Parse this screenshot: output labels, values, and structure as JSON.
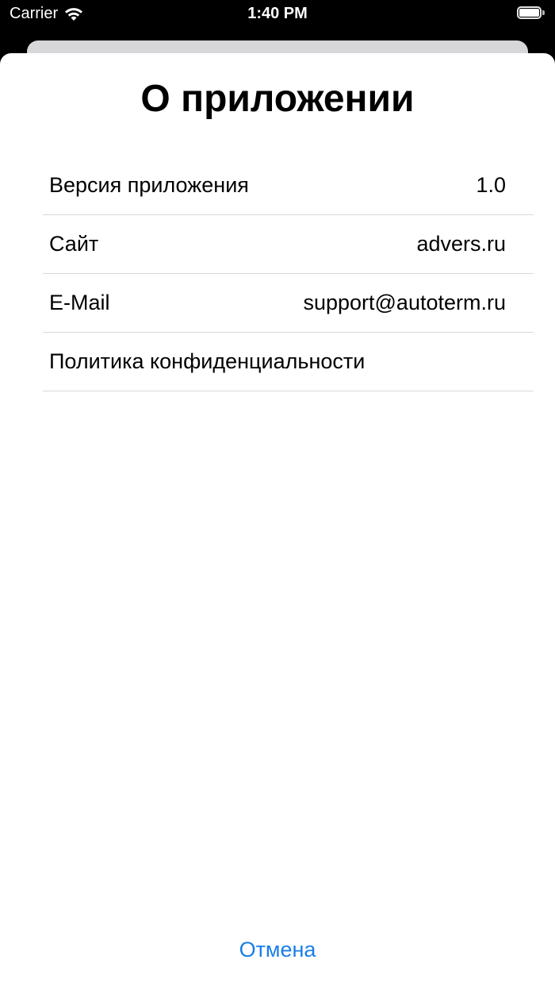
{
  "status_bar": {
    "carrier": "Carrier",
    "time": "1:40 PM",
    "icons": [
      "wifi-icon",
      "battery-icon"
    ]
  },
  "sheet": {
    "title": "О приложении",
    "rows": [
      {
        "label": "Версия приложения",
        "value": "1.0"
      },
      {
        "label": "Сайт",
        "value": "advers.ru"
      },
      {
        "label": "E-Mail",
        "value": "support@autoterm.ru"
      },
      {
        "label": "Политика конфиденциальности",
        "value": ""
      }
    ],
    "cancel_label": "Отмена"
  },
  "colors": {
    "accent": "#1a7ee8",
    "separator": "#d8d8da",
    "background": "#000000",
    "sheet": "#ffffff"
  }
}
